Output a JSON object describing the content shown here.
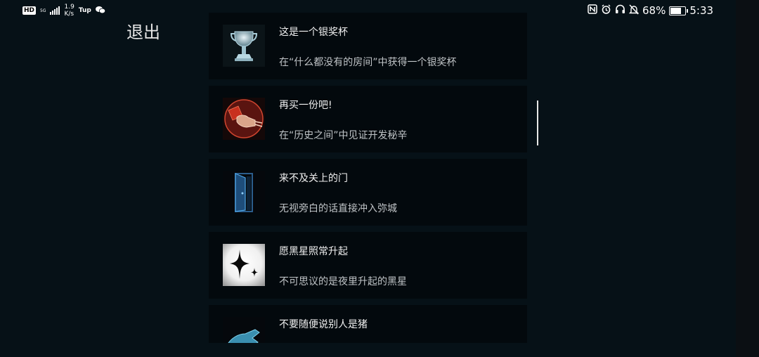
{
  "status_bar": {
    "hd": "HD",
    "network": "5G",
    "speed_value": "1.9",
    "speed_unit": "K/s",
    "app_label": "Tup",
    "battery": "68%",
    "time": "5:33",
    "battery_level": 0.68
  },
  "exit_label": "退出",
  "achievements": [
    {
      "title": "这是一个银奖杯",
      "desc": "在“什么都没有的房间”中获得一个银奖杯",
      "icon": "silver-trophy"
    },
    {
      "title": "再买一份吧!",
      "desc": "在“历史之间”中见证开发秘辛",
      "icon": "fist-with-money"
    },
    {
      "title": "来不及关上的门",
      "desc": "无视旁白的话直接冲入弥城",
      "icon": "open-door"
    },
    {
      "title": "愿黑星照常升起",
      "desc": "不可思议的是夜里升起的黑星",
      "icon": "black-star"
    },
    {
      "title": "不要随便说别人是猪",
      "desc": "",
      "icon": "blue-hand"
    }
  ]
}
